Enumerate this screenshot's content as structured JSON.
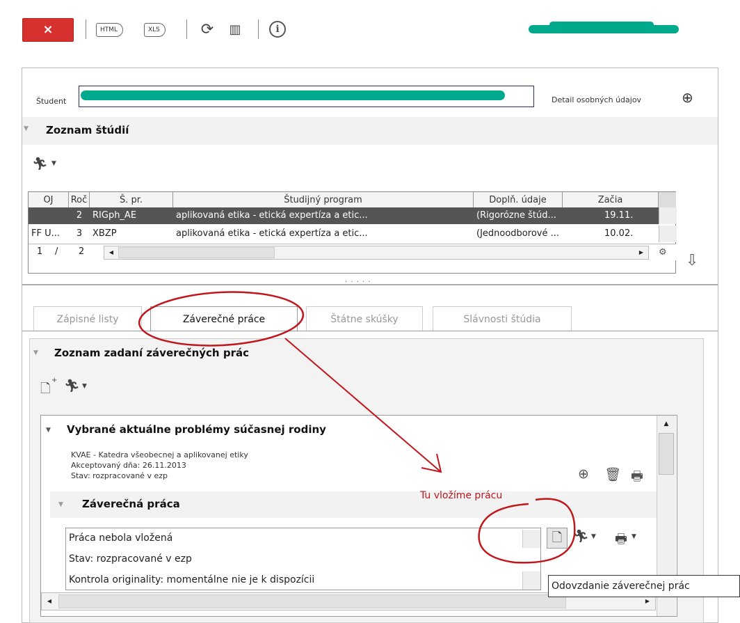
{
  "toolbar": {
    "close_label": "×",
    "html_label": "HTML",
    "xls_label": "XLS",
    "info_label": "i"
  },
  "student": {
    "label": "Študent",
    "detail_label": "Detail osobných údajov"
  },
  "studies": {
    "title": "Zoznam štúdií",
    "columns": [
      "OJ",
      "Roč",
      "Š. pr.",
      "Študijný program",
      "Doplň. údaje",
      "Začia"
    ],
    "rows": [
      {
        "oj": "",
        "roc": "2",
        "spr": "RIGph_AE",
        "program": "aplikovaná etika - etická expertíza a etic...",
        "dopln": "(Rigorózne štúd...",
        "zac": "19.11."
      },
      {
        "oj": "FF U...",
        "roc": "3",
        "spr": "XBZP",
        "program": "aplikovaná etika - etická expertíza a etic...",
        "dopln": "(Jednoodborové ...",
        "zac": "10.02."
      }
    ],
    "pager": {
      "current": "1",
      "sep": "/",
      "total": "2"
    },
    "splitter": "· · · · ·"
  },
  "tabs": [
    "Zápisné listy",
    "Záverečné práce",
    "Štátne skúšky",
    "Slávnosti štúdia"
  ],
  "theses": {
    "title": "Zoznam zadaní záverečných prác",
    "item": {
      "title": "Vybrané aktuálne problémy súčasnej rodiny",
      "dept": "KVAE - Katedra všeobecnej a aplikovanej etiky",
      "accepted": "Akceptovaný dňa: 26.11.2013",
      "state": "Stav: rozpracované v ezp"
    },
    "final_work": {
      "title": "Záverečná práca",
      "lines": [
        "Práca nebola vložená",
        "Stav: rozpracované v ezp",
        "Kontrola originality: momentálne nie je k dispozícii"
      ]
    }
  },
  "annotation": {
    "text": "Tu vložíme prácu",
    "tooltip": "Odovzdanie záverečnej prác"
  },
  "colors": {
    "close_red": "#d6312f",
    "annotation_red": "#c0161c",
    "redaction": "#00a98c",
    "selected_row": "#555555"
  }
}
